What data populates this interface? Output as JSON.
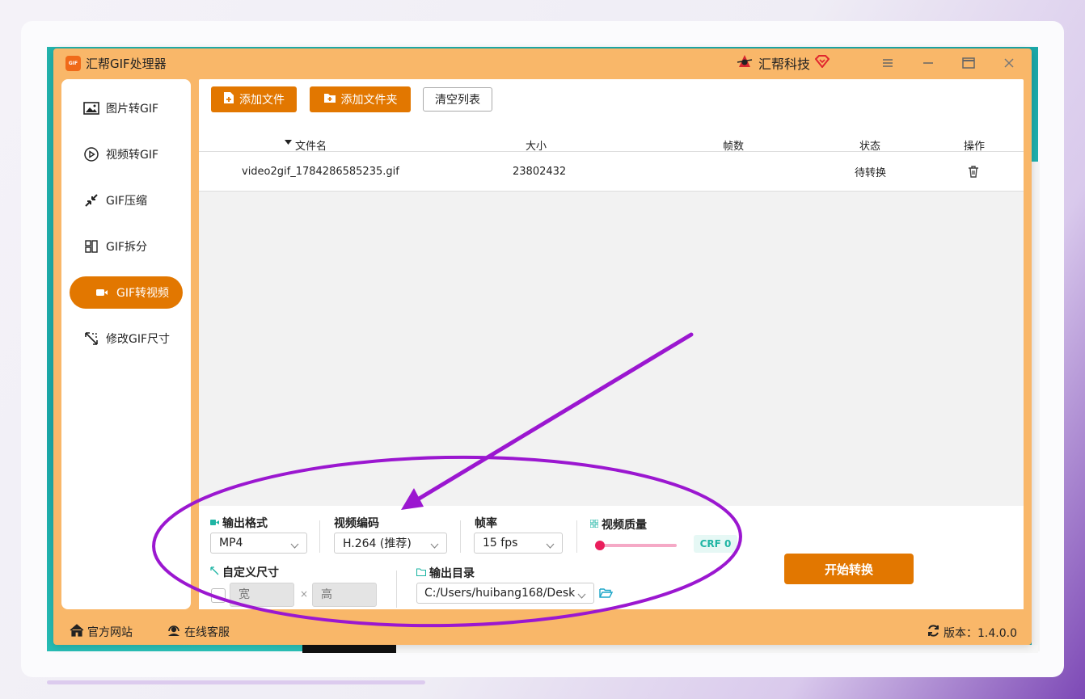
{
  "app": {
    "title": "汇帮GIF处理器",
    "logo_text": "GIF",
    "brand": "汇帮科技"
  },
  "sidebar": {
    "items": [
      {
        "label": "图片转GIF",
        "icon": "image-icon"
      },
      {
        "label": "视频转GIF",
        "icon": "play-icon"
      },
      {
        "label": "GIF压缩",
        "icon": "compress-icon"
      },
      {
        "label": "GIF拆分",
        "icon": "split-icon"
      },
      {
        "label": "GIF转视频",
        "icon": "video-camera-icon",
        "active": true
      },
      {
        "label": "修改GIF尺寸",
        "icon": "resize-icon"
      }
    ]
  },
  "toolbar": {
    "add_file": "添加文件",
    "add_folder": "添加文件夹",
    "clear_list": "清空列表"
  },
  "table": {
    "columns": [
      "文件名",
      "大小",
      "帧数",
      "状态",
      "操作"
    ],
    "rows": [
      {
        "name": "video2gif_1784286585235.gif",
        "size": "23802432",
        "frames": "",
        "status": "待转换",
        "action_icon": "trash-icon"
      }
    ]
  },
  "settings": {
    "format_label": "输出格式",
    "format_value": "MP4",
    "codec_label": "视频编码",
    "codec_value": "H.264 (推荐)",
    "fps_label": "帧率",
    "fps_value": "15 fps",
    "quality_label": "视频质量",
    "quality_value": 0,
    "crf_badge": "CRF 0",
    "size_label": "自定义尺寸",
    "width_placeholder": "宽",
    "height_placeholder": "高",
    "times": "×",
    "output_label": "输出目录",
    "output_value": "C:/Users/huibang168/Desk",
    "start_button": "开始转换"
  },
  "footer": {
    "website": "官方网站",
    "support": "在线客服",
    "version": "版本：1.4.0.0"
  },
  "colors": {
    "accent": "#e27700",
    "window": "#f9b769",
    "annotation": "#9b17d0"
  }
}
